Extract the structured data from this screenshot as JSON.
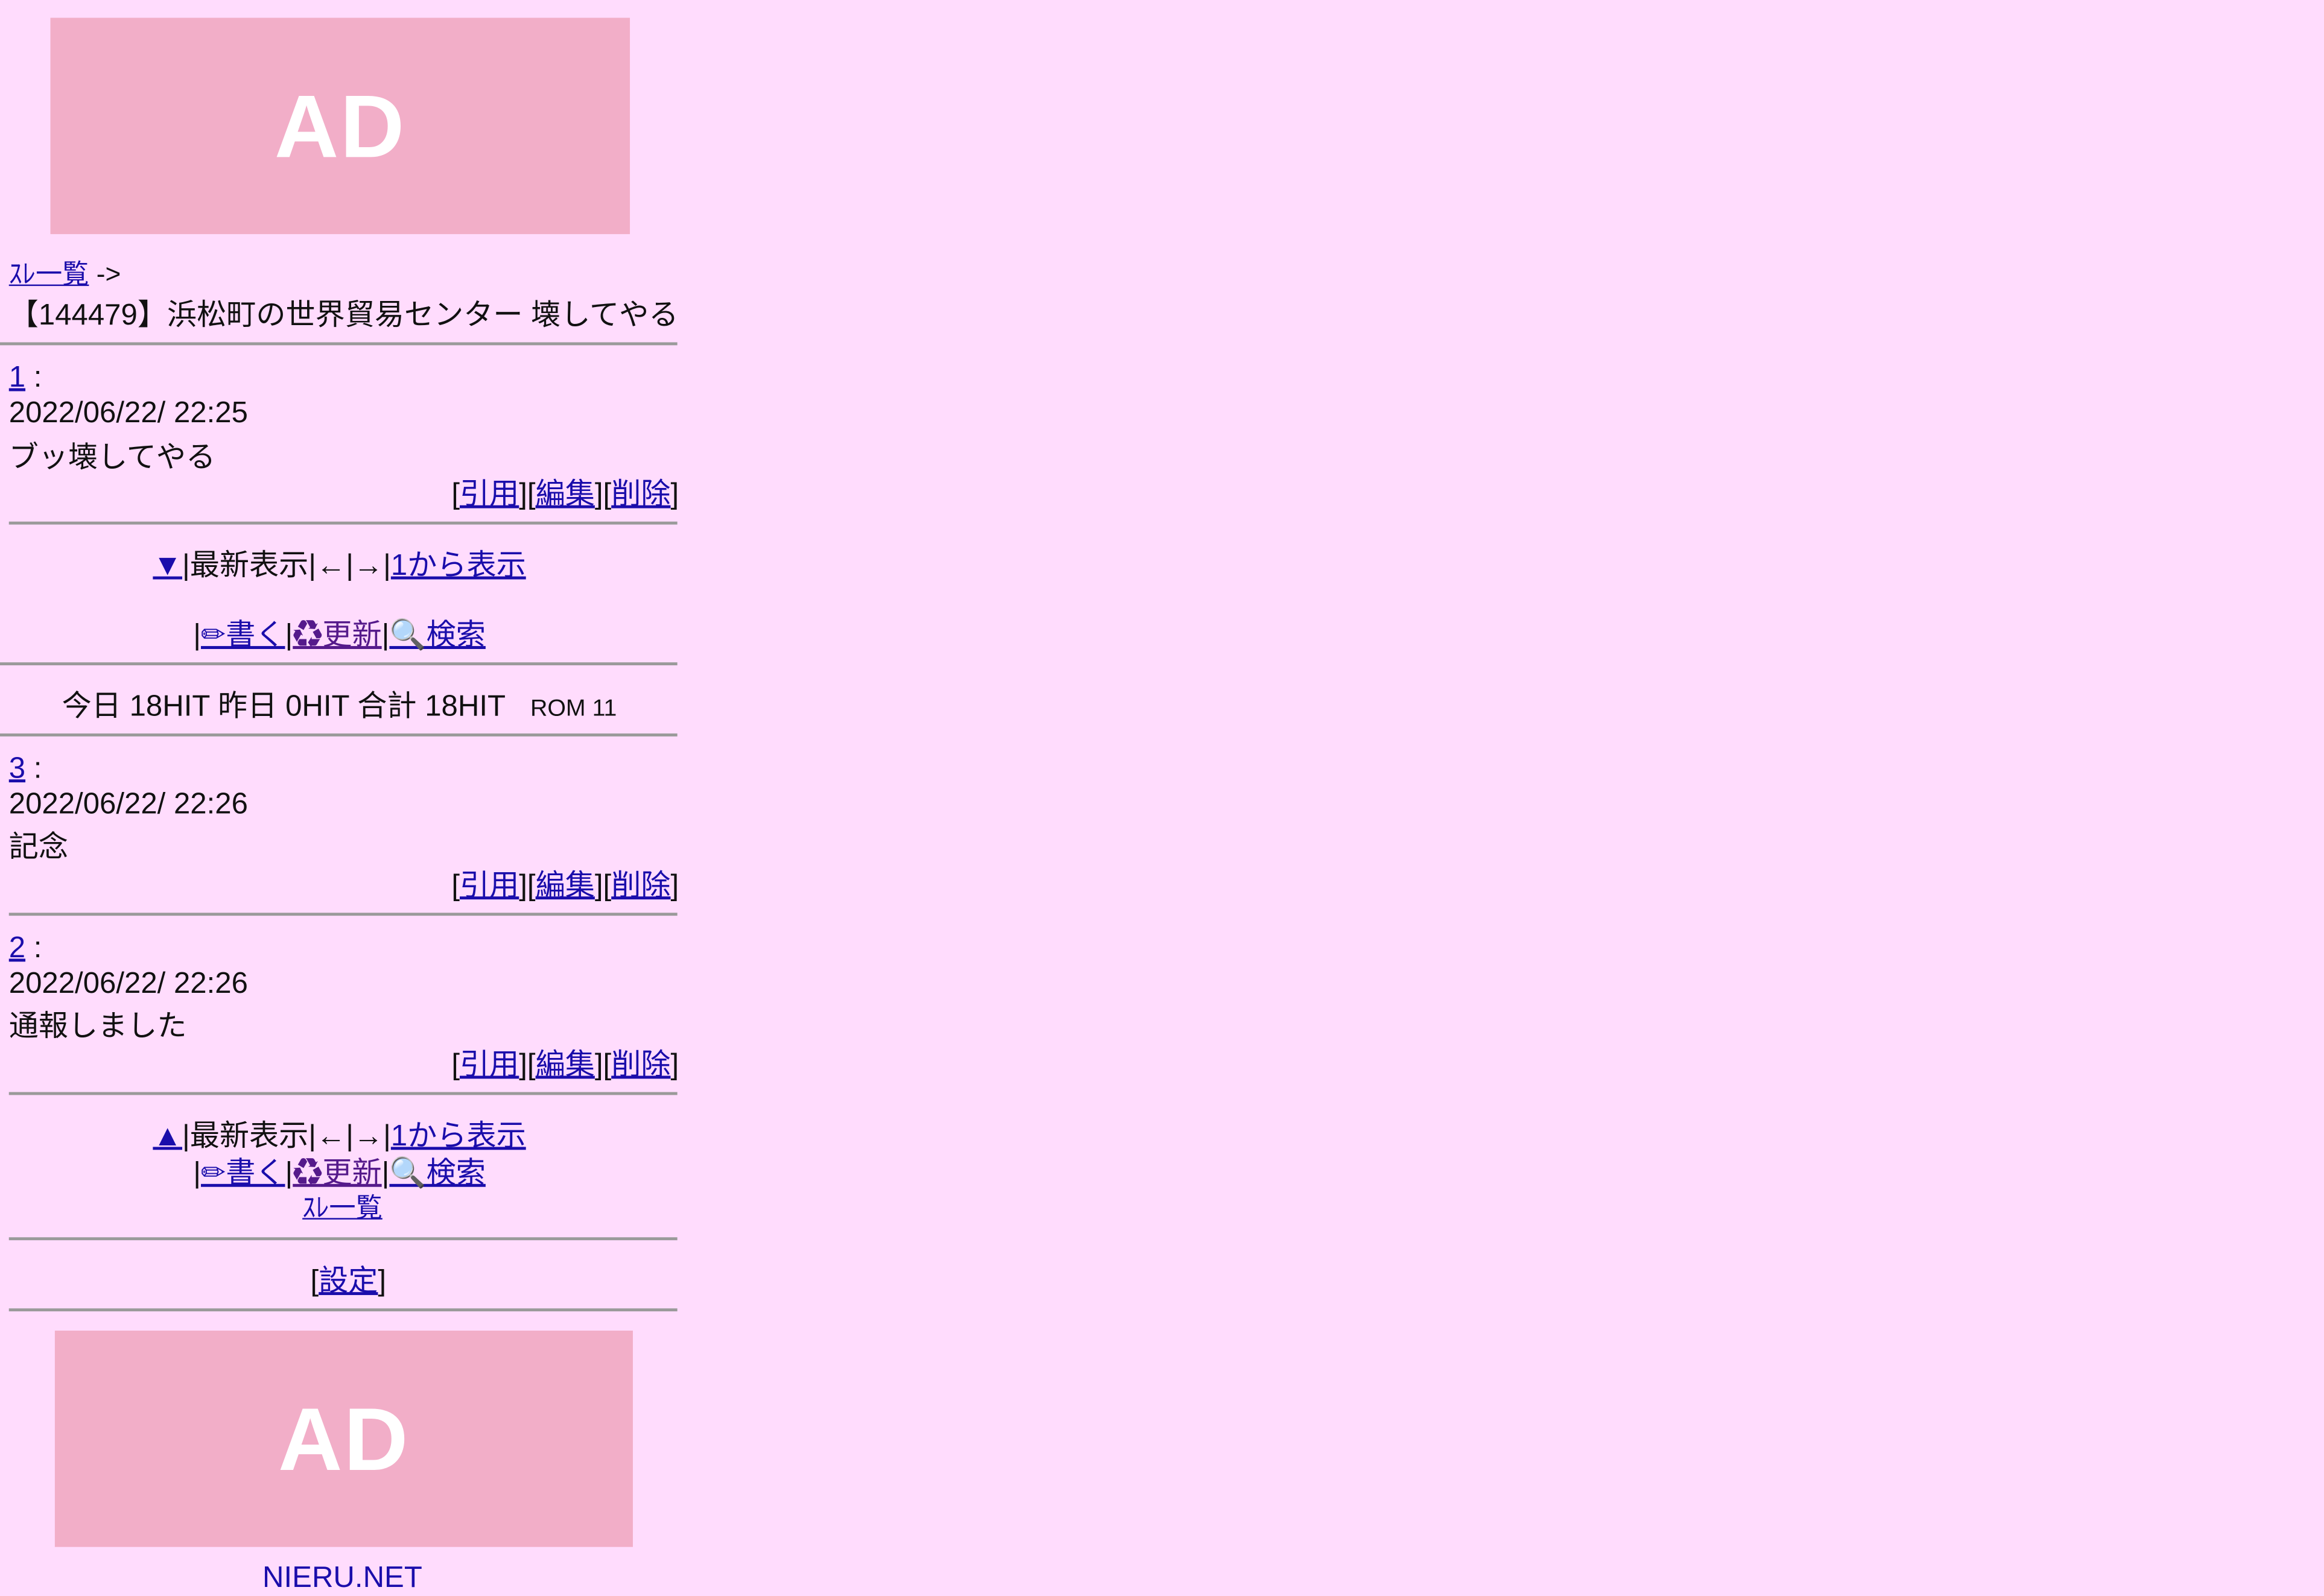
{
  "thread_list_link": "ｽﾚ一覧",
  "breadcrumb_arrow": "->",
  "thread_title": "【144479】浜松町の世界貿易センター 壊してやる",
  "ad_label": "AD",
  "action_links": {
    "quote": "引用",
    "edit": "編集",
    "delete": "削除"
  },
  "posts": [
    {
      "number": "1",
      "date": "2022/06/22/ 22:25",
      "body": "ブッ壊してやる"
    },
    {
      "number": "3",
      "date": "2022/06/22/ 22:26",
      "body": "記念"
    },
    {
      "number": "2",
      "date": "2022/06/22/ 22:26",
      "body": "通報しました"
    }
  ],
  "nav": {
    "down_arrow": "▼",
    "up_arrow": "▲",
    "latest": "|最新表示|←|→|",
    "from_first": "1から表示",
    "write": "✏書く",
    "refresh": "♻更新",
    "search": "🔍検索",
    "sep": "|"
  },
  "hits": {
    "text": "今日 18HIT 昨日 0HIT 合計 18HIT",
    "rom": "ROM 11"
  },
  "settings": "設定",
  "footer_site": "NIERU.NET",
  "colors": {
    "background": "#ffdcfd",
    "ad": "#f2aec8",
    "link": "#1a0dab"
  }
}
